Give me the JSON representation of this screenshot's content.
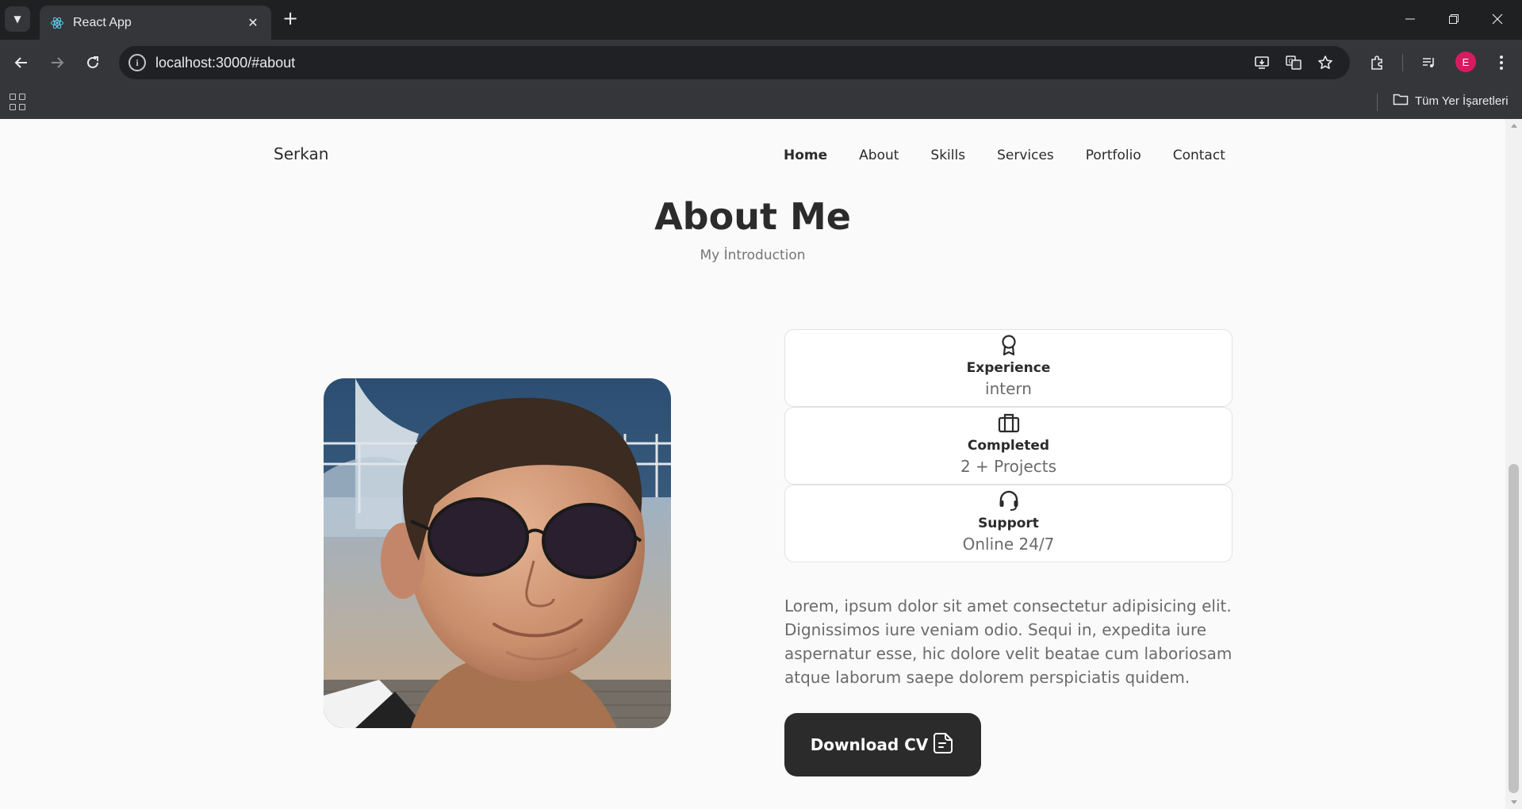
{
  "browser": {
    "tab": {
      "title": "React App",
      "favicon": "react-logo-icon"
    },
    "url": "localhost:3000/#about",
    "avatar_letter": "E",
    "accent_color": "#d81b60",
    "bookmarks_folder": "Tüm Yer İşaretleri"
  },
  "nav": {
    "brand": "Serkan",
    "links": [
      {
        "label": "Home",
        "active": true
      },
      {
        "label": "About",
        "active": false
      },
      {
        "label": "Skills",
        "active": false
      },
      {
        "label": "Services",
        "active": false
      },
      {
        "label": "Portfolio",
        "active": false
      },
      {
        "label": "Contact",
        "active": false
      }
    ]
  },
  "about": {
    "title": "About Me",
    "subtitle": "My İntroduction",
    "cards": [
      {
        "icon": "award-icon",
        "title": "Experience",
        "value": "intern"
      },
      {
        "icon": "briefcase-icon",
        "title": "Completed",
        "value": "2 + Projects"
      },
      {
        "icon": "headset-icon",
        "title": "Support",
        "value": "Online 24/7"
      }
    ],
    "description": "Lorem, ipsum dolor sit amet consectetur adipisicing elit. Dignissimos iure veniam odio. Sequi in, expedita iure aspernatur esse, hic dolore velit beatae cum laboriosam atque laborum saepe dolorem perspiciatis quidem.",
    "cv_button": "Download CV"
  }
}
